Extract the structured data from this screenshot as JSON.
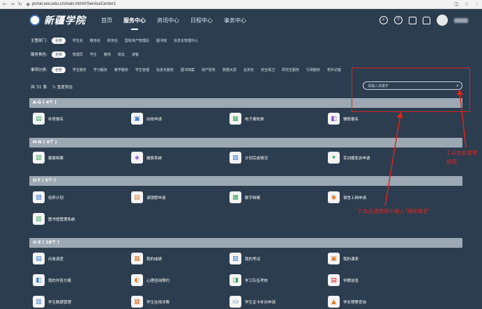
{
  "browser": {
    "url": "portal.xeu.edu.cn/main.html#/ServiceCenter1"
  },
  "header": {
    "logo_text": "新疆学院",
    "nav": [
      {
        "label": "首页",
        "active": false
      },
      {
        "label": "服务中心",
        "active": true
      },
      {
        "label": "资讯中心",
        "active": false
      },
      {
        "label": "日程中心",
        "active": false
      },
      {
        "label": "事务中心",
        "active": false
      }
    ]
  },
  "filters": {
    "dept": {
      "label": "主管部门:",
      "options": [
        "全部",
        "学生处",
        "教务处",
        "财务处",
        "国有资产管理处",
        "图书馆",
        "信息化管理中心"
      ]
    },
    "role": {
      "label": "服务角色:",
      "options": [
        "全部",
        "管理员",
        "学生",
        "教师",
        "校友",
        "游客"
      ]
    },
    "type": {
      "label": "事项分类:",
      "options": [
        "全部",
        "学生服务",
        "学习服务",
        "教学服务",
        "学生管理",
        "信息化服务",
        "图书档案",
        "资产财务",
        "数据大屏",
        "总务处",
        "安全保卫",
        "研究生服务",
        "行政服务",
        "校外访客"
      ]
    }
  },
  "summary": {
    "total": "共 31 条",
    "reset": "重置筛选"
  },
  "search": {
    "placeholder": "请输入关键字"
  },
  "categories": [
    {
      "title": "A-G ( 4个 )",
      "items": [
        {
          "name": "补修报名",
          "icon": "book-icon"
        },
        {
          "name": "出校申请",
          "icon": "gate-icon"
        },
        {
          "name": "电子离校单",
          "icon": "document-icon"
        },
        {
          "name": "辅修报名",
          "icon": "register-icon"
        }
      ]
    },
    {
      "title": "H-N ( 4个 )",
      "items": [
        {
          "name": "健康档案",
          "icon": "health-icon"
        },
        {
          "name": "缴费系统",
          "icon": "payment-icon"
        },
        {
          "name": "计划完成情况",
          "icon": "plan-icon"
        },
        {
          "name": "军训缓免训申请",
          "icon": "military-icon"
        }
      ]
    },
    {
      "title": "O-T ( 5个 )",
      "items": [
        {
          "name": "培养计划",
          "icon": "training-icon"
        },
        {
          "name": "请销假申请",
          "icon": "leave-icon"
        },
        {
          "name": "数字档案",
          "icon": "archive-icon"
        },
        {
          "name": "宿舍上网申请",
          "icon": "network-icon"
        },
        {
          "name": "图书馆管理系统",
          "icon": "library-icon"
        }
      ]
    },
    {
      "title": "U-Z ( 18个 )",
      "items": [
        {
          "name": "问卷调查",
          "icon": "survey-icon"
        },
        {
          "name": "我的成绩",
          "icon": "grades-icon"
        },
        {
          "name": "我的考试",
          "icon": "exam-icon"
        },
        {
          "name": "我的课表",
          "icon": "schedule-icon"
        },
        {
          "name": "我的作答方案",
          "icon": "answer-icon"
        },
        {
          "name": "心理咨询预约",
          "icon": "counsel-icon"
        },
        {
          "name": "学工队伍考核",
          "icon": "assessment-icon"
        },
        {
          "name": "学籍信息",
          "icon": "student-record-icon"
        },
        {
          "name": "学生数据管理",
          "icon": "data-icon"
        },
        {
          "name": "学生在线评教",
          "icon": "evaluation-icon"
        },
        {
          "name": "学生证卡补办申请",
          "icon": "card-icon"
        },
        {
          "name": "学业预警查询",
          "icon": "warning-icon"
        }
      ]
    }
  ],
  "annotations": {
    "step1": "1.点击此搜索",
    "step1b": "按钮",
    "step2": "2.在此搜索框中输入\"辅修报名\""
  },
  "colors": {
    "bg": "#2b3d4f",
    "category_bar": "#9ca8b4",
    "annotation": "#e0251b"
  }
}
